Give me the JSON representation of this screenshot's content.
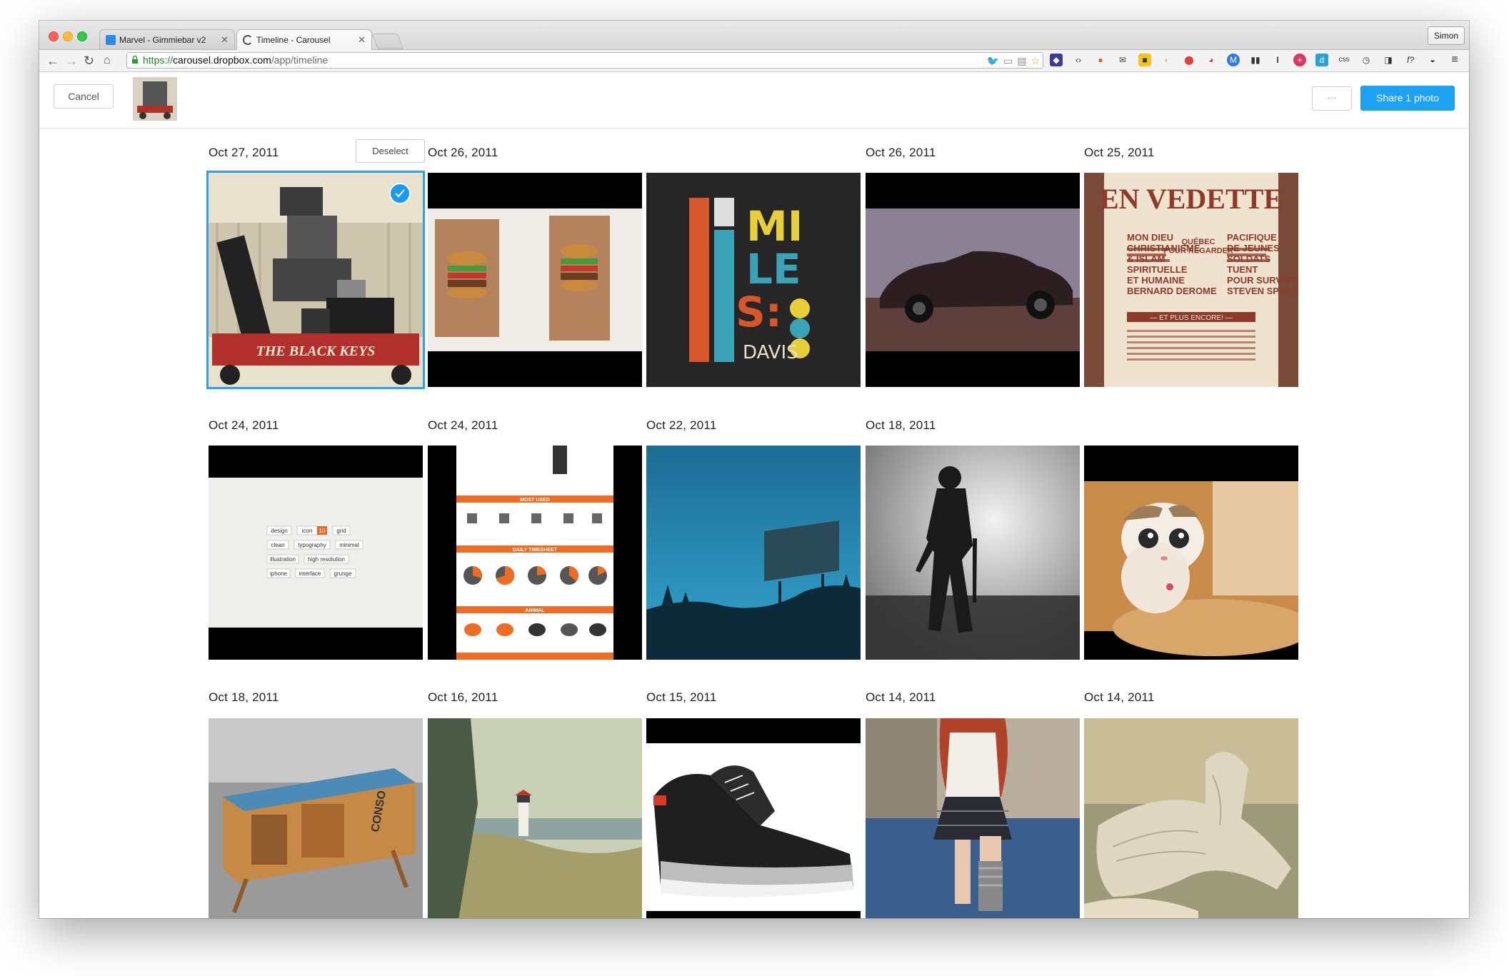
{
  "browser": {
    "tabs": [
      {
        "title": "Marvel - Gimmiebar v2",
        "active": false
      },
      {
        "title": "Timeline - Carousel",
        "active": true
      }
    ],
    "profile_name": "Simon",
    "url_scheme": "https://",
    "url_host": "carousel.dropbox.com",
    "url_path": "/app/timeline"
  },
  "header": {
    "cancel_label": "Cancel",
    "more_label": "◦◦◦",
    "share_label": "Share 1 photo"
  },
  "grid": {
    "deselect_label": "Deselect",
    "rows": [
      {
        "dates": [
          "Oct 27, 2011",
          "Oct 26, 2011",
          "",
          "Oct 26, 2011",
          "Oct 25, 2011"
        ]
      },
      {
        "dates": [
          "Oct 24, 2011",
          "Oct 24, 2011",
          "Oct 22, 2011",
          "Oct 18, 2011",
          ""
        ]
      },
      {
        "dates": [
          "Oct 18, 2011",
          "Oct 16, 2011",
          "Oct 15, 2011",
          "Oct 14, 2011",
          "Oct 14, 2011"
        ]
      }
    ]
  },
  "photo_text": {
    "black_keys": "THE BLACK KEYS",
    "miles_1": "MI",
    "miles_2": "LE",
    "miles_3": "S:",
    "miles_4": "DAVIS",
    "vedette_title": "EN VEDETTE",
    "vedette_left": "MON DIEU\nCHRISTIANISME\n& ISLAM\nSPIRITUELLE\nET HUMAINE\nBERNARD DEROME",
    "vedette_right": "PACIFIQUE\nDE JEUNES\nSOLDATS\nTUENT\nPOUR SURVIVRE\nSTEVEN SPIELBERG",
    "vedette_mid": "QUÉBEC\nPOUR REGARDER",
    "vedette_band": "— ET PLUS ENCORE! —",
    "tags": [
      "design",
      "icon",
      "10",
      "grid",
      "clean",
      "typography",
      "minimal",
      "illustration",
      "high resolution",
      "iphone",
      "interface",
      "grunge"
    ],
    "info_most_used": "MOST USED",
    "info_daily": "DAILY TIMESHEET",
    "info_animal": "ANIMAL",
    "crate_text": "CONSO"
  },
  "colors": {
    "accent": "#1da1f2",
    "selection": "#2f9ff0"
  }
}
